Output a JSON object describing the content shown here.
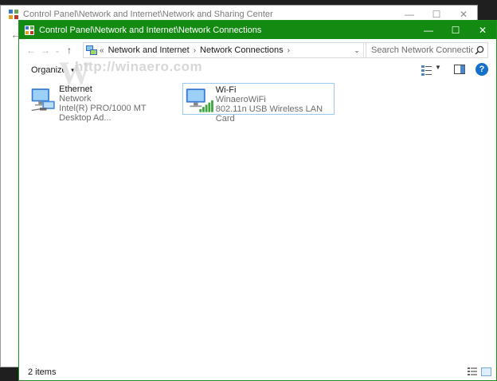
{
  "background_window": {
    "title": "Control Panel\\Network and Internet\\Network and Sharing Center",
    "minimize": "—",
    "maximize": "☐",
    "close": "✕",
    "back": "←"
  },
  "window": {
    "title": "Control Panel\\Network and Internet\\Network Connections",
    "minimize": "—",
    "maximize": "☐",
    "close": "✕",
    "accent": "#138a12"
  },
  "nav": {
    "back": "←",
    "forward": "→",
    "recent": "⌄",
    "up": "↑"
  },
  "address": {
    "overflow": "«",
    "crumbs": [
      "Network and Internet",
      "Network Connections"
    ],
    "sep": "›",
    "dropdown": "⌄",
    "refresh": "↻"
  },
  "search": {
    "placeholder": "Search Network Connections"
  },
  "commands": {
    "organize": "Organize",
    "organize_caret": "▼",
    "view_caret": "▼",
    "help": "?"
  },
  "watermark": {
    "text": "http://winaero.com",
    "logo": "W"
  },
  "connections": [
    {
      "name": "Ethernet",
      "status": "Network",
      "device": "Intel(R) PRO/1000 MT Desktop Ad...",
      "icon": "ethernet-adapter-icon"
    },
    {
      "name": "Wi-Fi",
      "status": "WinaeroWiFi",
      "device": "802.11n USB Wireless LAN Card",
      "icon": "wifi-adapter-icon",
      "selected": true
    }
  ],
  "status": {
    "item_count": "2 items"
  }
}
